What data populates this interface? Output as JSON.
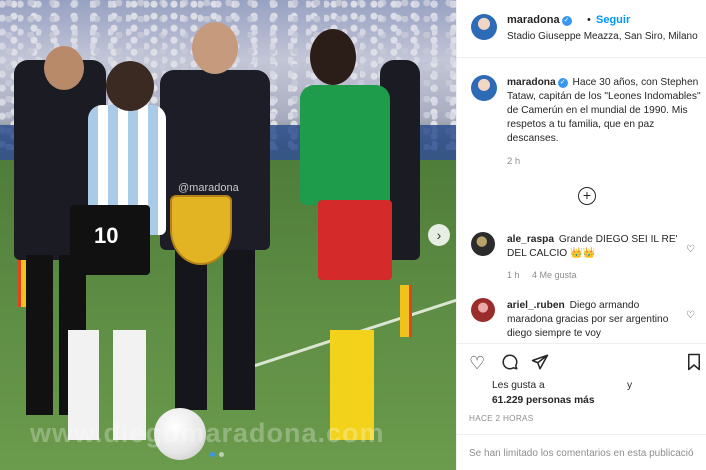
{
  "post": {
    "username": "maradona",
    "follow_separator": "•",
    "follow_label": "Seguir",
    "location": "Stadio Giuseppe Meazza, San Siro, Milano"
  },
  "photo": {
    "watermark": "www.diegomaradona.com",
    "center_tag": "@maradona",
    "shirt_number": "10",
    "carousel_dots": 2,
    "active_dot": 1,
    "next_arrow": "›"
  },
  "caption": {
    "username": "maradona",
    "text": "Hace 30 años, con Stephen Tataw, capitán de los \"Leones Indomables\" de Camerún en el mundial de 1990. Mis respetos a tu familia, que en paz descanses.",
    "time": "2 h"
  },
  "load_more_symbol": "+",
  "comments": [
    {
      "username": "ale_raspa",
      "text": "Grande DIEGO SEI IL RE' DEL CALCIO 👑👑",
      "time": "1 h",
      "likes": "4 Me gusta"
    },
    {
      "username": "ariel_.ruben",
      "text": "Diego armando maradona gracias por ser argentino diego siempre te voy",
      "time": "",
      "likes": ""
    }
  ],
  "actions": {
    "likes_prefix": "Les gusta a",
    "likes_and": "y",
    "likes_count": "61.229 personas más",
    "date": "HACE 2 HORAS",
    "comments_limited": "Se han limitado los comentarios en esta publicació"
  },
  "colors": {
    "link_blue": "#0095f6",
    "verified_blue": "#3897f0",
    "muted_text": "#8e8e8e"
  }
}
